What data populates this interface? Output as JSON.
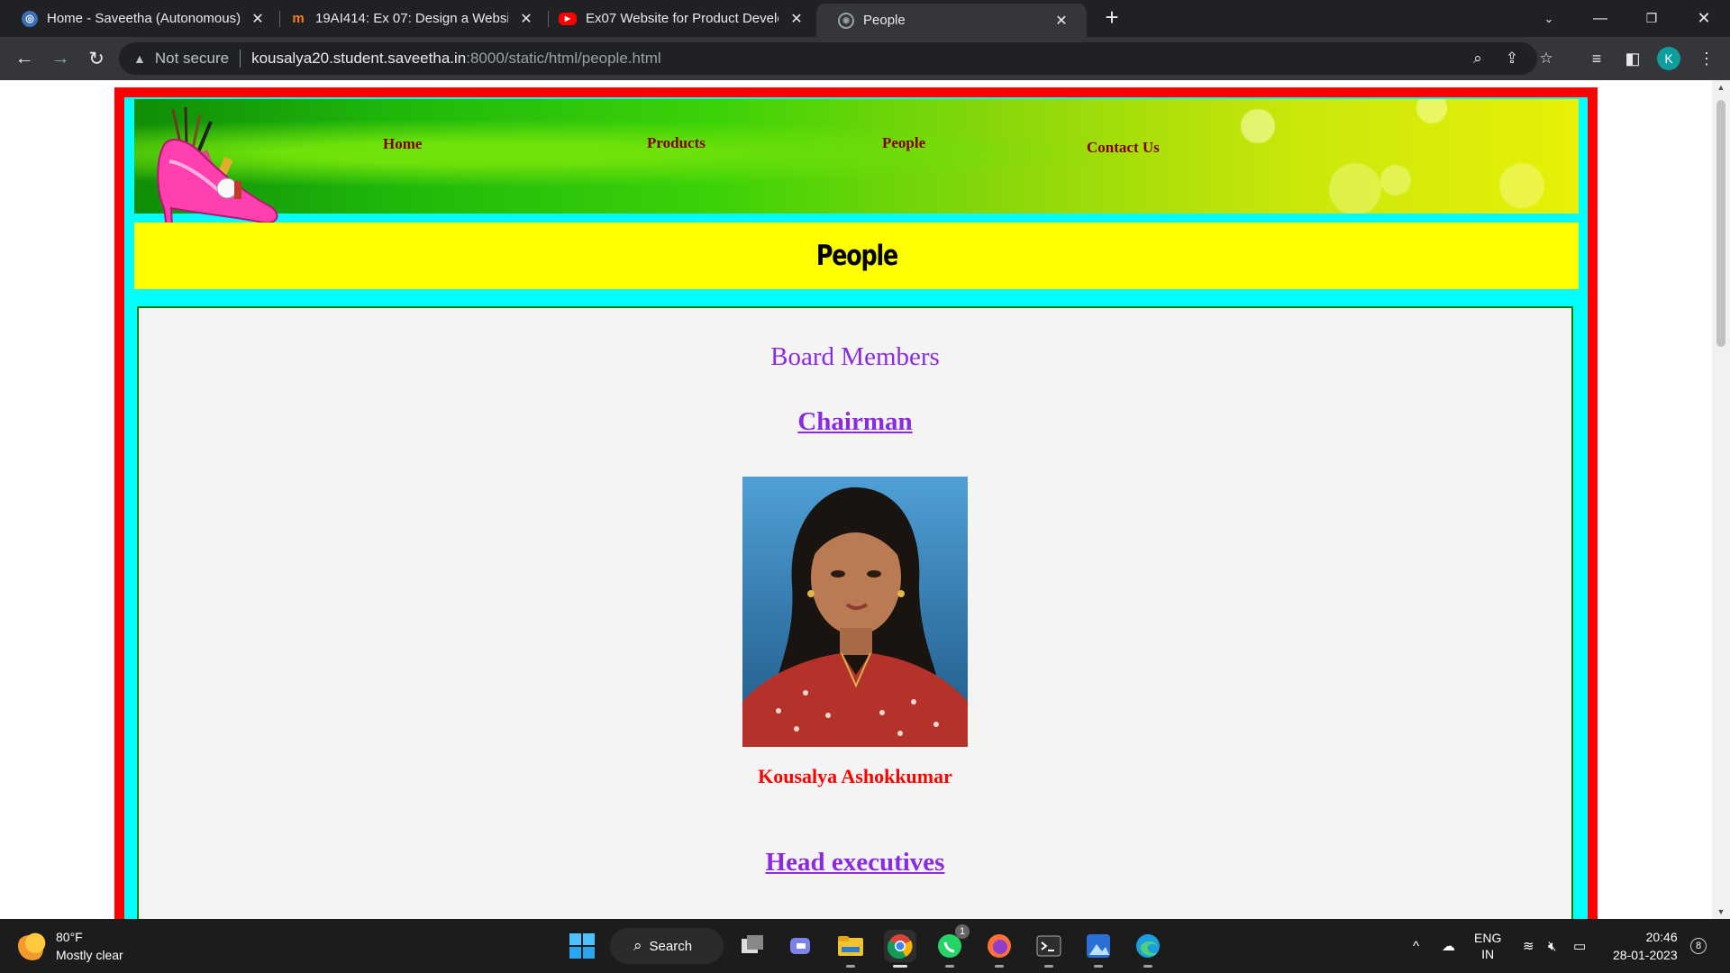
{
  "browser": {
    "tabs": [
      {
        "title": "Home - Saveetha (Autonomous)",
        "favicon": "saveetha-logo-icon",
        "active": false
      },
      {
        "title": "19AI414: Ex 07: Design a Website",
        "favicon": "moodle-icon",
        "active": false
      },
      {
        "title": "Ex07 Website for Product Develo",
        "favicon": "youtube-icon",
        "active": false
      },
      {
        "title": "People",
        "favicon": "globe-icon",
        "active": true
      }
    ],
    "address": {
      "security_label": "Not secure",
      "host": "kousalya20.student.saveetha.in",
      "path": ":8000/static/html/people.html"
    },
    "profile_initial": "K"
  },
  "page": {
    "nav": {
      "home": "Home",
      "products": "Products",
      "people": "People",
      "contact": "Contact Us"
    },
    "heading": "People",
    "section_title": "Board Members",
    "roles": {
      "chairman": "Chairman",
      "head_executives": "Head executives"
    },
    "chairman_name": "Kousalya Ashokkumar"
  },
  "taskbar": {
    "weather": {
      "temp": "80°F",
      "condition": "Mostly clear"
    },
    "search_label": "Search",
    "whatsapp_badge": "1",
    "language": {
      "lang": "ENG",
      "region": "IN"
    },
    "time": "20:46",
    "date": "28-01-2023",
    "notification_count": "8"
  },
  "colors": {
    "frame_outer": "#ff0000",
    "frame_inner": "#00ffff",
    "title_bar": "#ffff00",
    "nav_text": "#800000",
    "section_text": "#8a2be2",
    "name_text": "#ff0000"
  }
}
